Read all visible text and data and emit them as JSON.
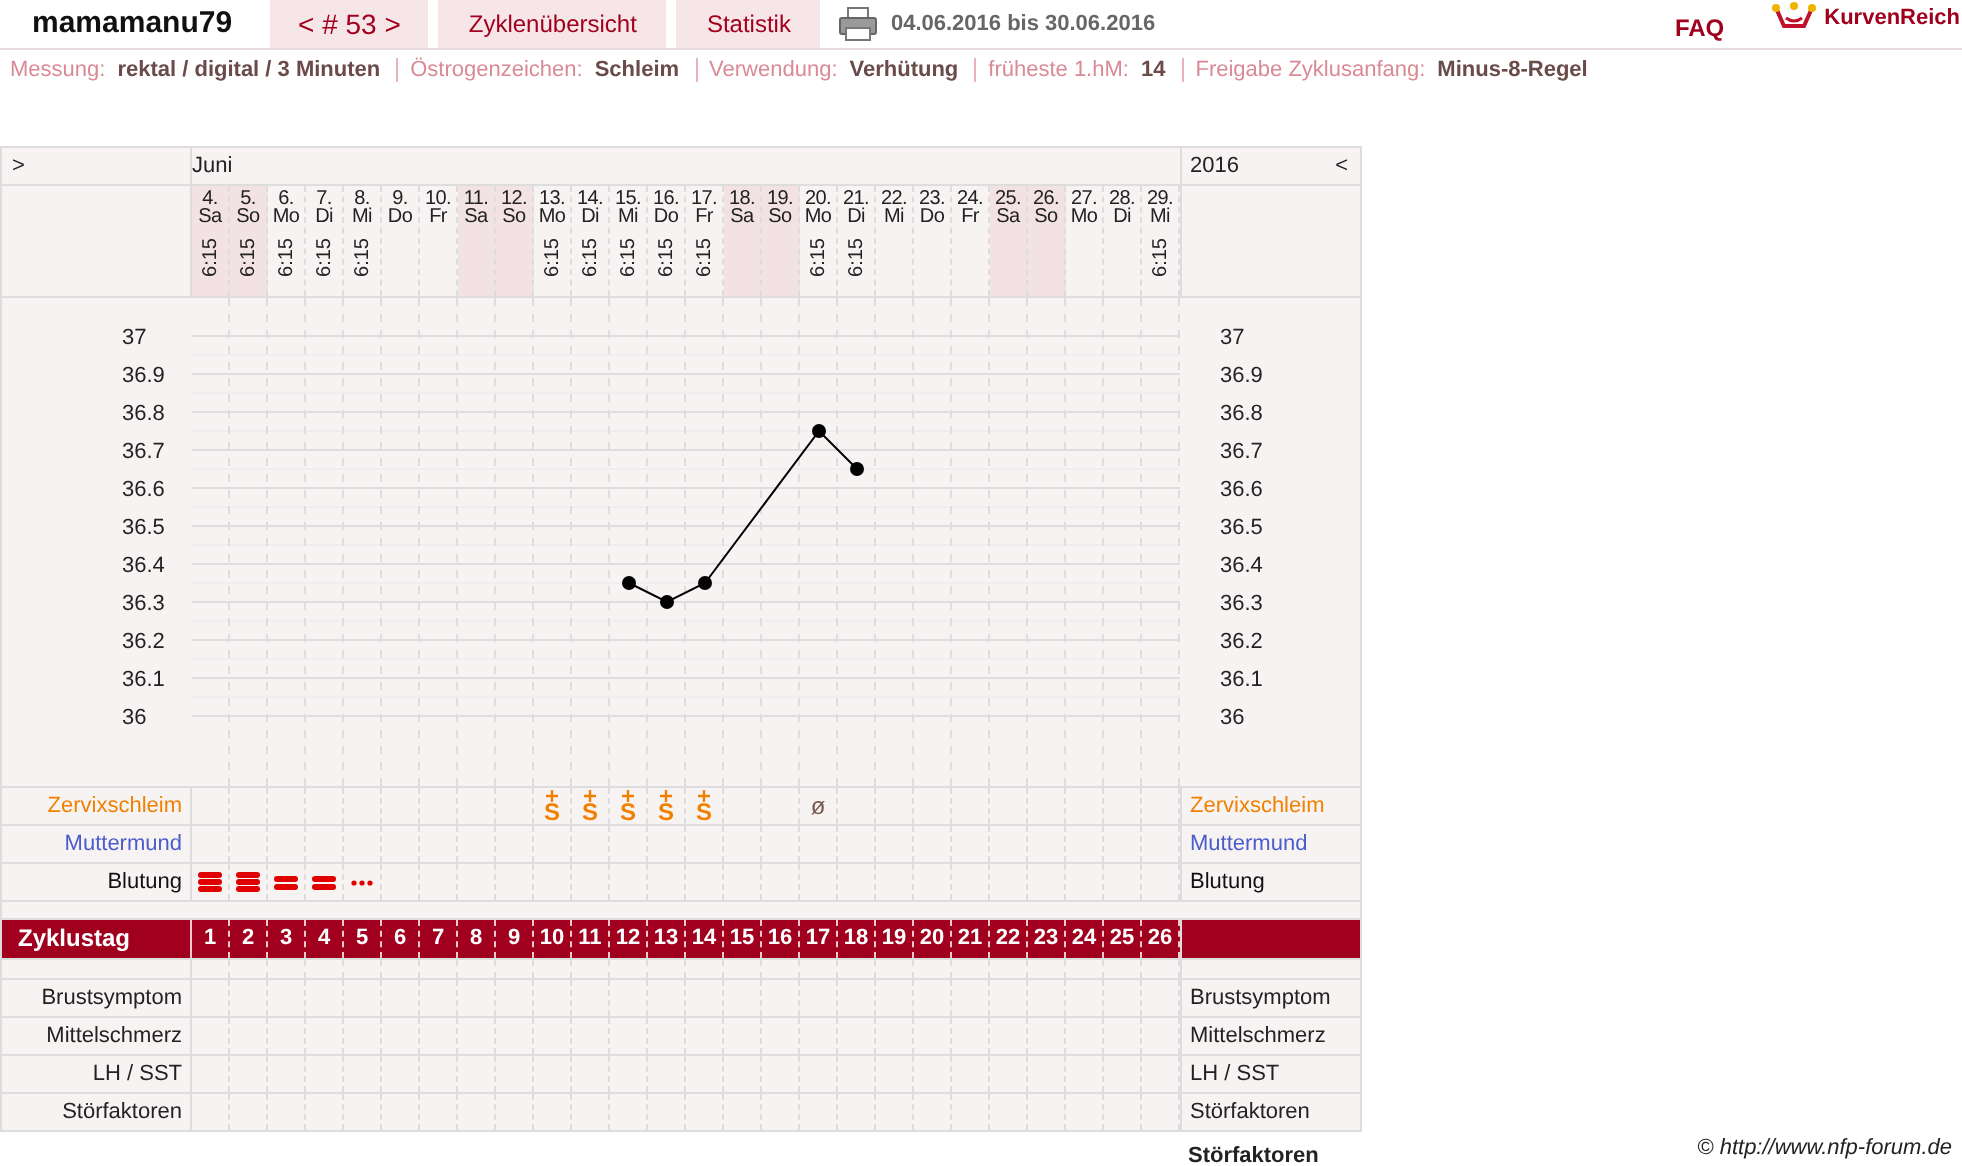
{
  "header": {
    "user": "mamamanu79",
    "cycle_nav": "< # 53 >",
    "nav_links": [
      "Zyklenübersicht",
      "Statistik"
    ],
    "date_range": "04.06.2016 bis 30.06.2016",
    "faq": "FAQ",
    "logo_text": "KurvenReich"
  },
  "info": [
    {
      "label": "Messung:",
      "value": "rektal / digital / 3 Minuten"
    },
    {
      "label": "Östrogenzeichen:",
      "value": "Schleim"
    },
    {
      "label": "Verwendung:",
      "value": "Verhütung"
    },
    {
      "label": "früheste 1.hM:",
      "value": "14"
    },
    {
      "label": "Freigabe Zyklusanfang:",
      "value": "Minus-8-Regel"
    }
  ],
  "calendar": {
    "prev": ">",
    "month": "Juni",
    "year": "2016",
    "next": "<",
    "days": [
      {
        "weekday": "Sa",
        "weekend": true,
        "time": "6:15",
        "cycle_day": "1",
        "bleeding": {
          "kind": "heavy"
        }
      },
      {
        "weekday": "So",
        "weekend": true,
        "time": "6:15",
        "cycle_day": "2",
        "bleeding": {
          "kind": "heavy"
        }
      },
      {
        "weekday": "Mo",
        "weekend": false,
        "time": "6:15",
        "cycle_day": "3",
        "bleeding": {
          "kind": "medium"
        }
      },
      {
        "weekday": "Di",
        "weekend": false,
        "time": "6:15",
        "cycle_day": "4",
        "bleeding": {
          "kind": "medium"
        }
      },
      {
        "weekday": "Mi",
        "weekend": false,
        "time": "6:15",
        "cycle_day": "5",
        "bleeding": {
          "kind": "spotting"
        }
      },
      {
        "weekday": "Do",
        "weekend": false,
        "cycle_day": "6"
      },
      {
        "weekday": "Fr",
        "weekend": false,
        "cycle_day": "7"
      },
      {
        "weekday": "Sa",
        "weekend": true,
        "cycle_day": "8"
      },
      {
        "weekday": "So",
        "weekend": true,
        "cycle_day": "9"
      },
      {
        "weekday": "Mo",
        "weekend": false,
        "time": "6:15",
        "cycle_day": "10",
        "cervix": {
          "text": "S",
          "plus": true
        }
      },
      {
        "weekday": "Di",
        "weekend": false,
        "time": "6:15",
        "cycle_day": "11",
        "cervix": {
          "text": "S",
          "plus": true
        }
      },
      {
        "weekday": "Mi",
        "weekend": false,
        "time": "6:15",
        "cycle_day": "12",
        "cervix": {
          "text": "S",
          "plus": true
        }
      },
      {
        "weekday": "Do",
        "weekend": false,
        "time": "6:15",
        "cycle_day": "13",
        "cervix": {
          "text": "S",
          "plus": true
        }
      },
      {
        "weekday": "Fr",
        "weekend": false,
        "time": "6:15",
        "cycle_day": "14",
        "cervix": {
          "text": "S",
          "plus": true
        }
      },
      {
        "weekday": "Sa",
        "weekend": true,
        "cycle_day": "15"
      },
      {
        "weekday": "So",
        "weekend": true,
        "cycle_day": "16"
      },
      {
        "weekday": "Mo",
        "weekend": false,
        "time": "6:15",
        "cycle_day": "17",
        "cervix": {
          "text": "ø",
          "plus": false
        }
      },
      {
        "weekday": "Di",
        "weekend": false,
        "time": "6:15",
        "cycle_day": "18"
      },
      {
        "weekday": "Mi",
        "weekend": false,
        "cycle_day": "19"
      },
      {
        "weekday": "Do",
        "weekend": false,
        "cycle_day": "20"
      },
      {
        "weekday": "Fr",
        "weekend": false,
        "cycle_day": "21"
      },
      {
        "weekday": "Sa",
        "weekend": true,
        "cycle_day": "22"
      },
      {
        "weekday": "So",
        "weekend": true,
        "cycle_day": "23"
      },
      {
        "weekday": "Mo",
        "weekend": false,
        "cycle_day": "24"
      },
      {
        "weekday": "Di",
        "weekend": false,
        "cycle_day": "25"
      },
      {
        "weekday": "Mi",
        "weekend": false,
        "time": "6:15",
        "cycle_day": "26"
      }
    ]
  },
  "chart_data": {
    "type": "line",
    "categories": [
      "4.",
      "5.",
      "6.",
      "7.",
      "8.",
      "9.",
      "10.",
      "11.",
      "12.",
      "13.",
      "14.",
      "15.",
      "16.",
      "17.",
      "18.",
      "19.",
      "20.",
      "21.",
      "22.",
      "23.",
      "24.",
      "25.",
      "26.",
      "27.",
      "28.",
      "29."
    ],
    "series": [
      {
        "color": "#000000",
        "marker": true,
        "values": [
          null,
          null,
          null,
          null,
          null,
          null,
          null,
          null,
          null,
          null,
          null,
          36.35,
          36.3,
          36.35,
          null,
          null,
          36.75,
          36.65,
          null,
          null,
          null,
          null,
          null,
          null,
          null,
          null
        ]
      }
    ],
    "ylim": [
      36,
      37
    ],
    "yticks": [
      36,
      36.1,
      36.2,
      36.3,
      36.4,
      36.5,
      36.6,
      36.7,
      36.8,
      36.9,
      37
    ],
    "grid": true
  },
  "right_axis_labels": [
    "37",
    "36.9",
    "36.8",
    "36.7",
    "36.6",
    "36.5",
    "36.4",
    "36.3",
    "36.2",
    "36.1",
    "36"
  ],
  "sign_rows": [
    {
      "kind": "cervix",
      "label_left": "Zervixschleim",
      "label_right": "Zervixschleim"
    },
    {
      "kind": "cervix_os",
      "label_left": "Muttermund",
      "label_right": "Muttermund"
    },
    {
      "kind": "bleeding",
      "label_left": "Blutung",
      "label_right": "Blutung"
    }
  ],
  "cycle_day_label": "Zyklustag",
  "symptom_rows": [
    {
      "label_left": "Brustsymptom",
      "label_right": "Brustsymptom"
    },
    {
      "label_left": "Mittelschmerz",
      "label_right": "Mittelschmerz"
    },
    {
      "label_left": "LH / SST",
      "label_right": "LH / SST"
    },
    {
      "label_left": "Störfaktoren",
      "label_right": "Störfaktoren"
    }
  ],
  "copyright": "© http://www.nfp-forum.de",
  "bottom_label": "Störfaktoren"
}
